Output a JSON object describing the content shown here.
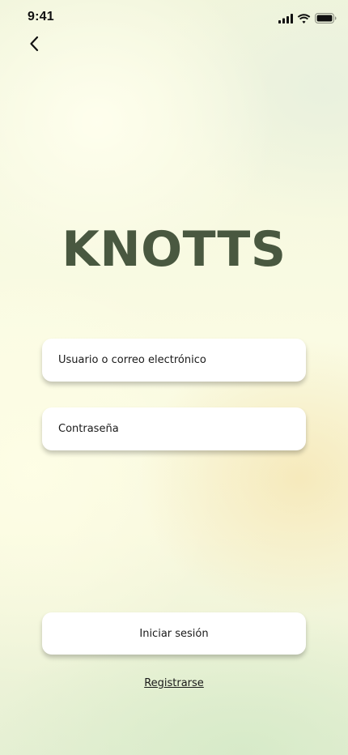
{
  "status_bar": {
    "time": "9:41",
    "icons": [
      "cellular-signal-icon",
      "wifi-icon",
      "battery-icon"
    ]
  },
  "navigation": {
    "back_icon": "chevron-left-icon"
  },
  "brand": {
    "logo_text": "KNOTTS",
    "logo_color": "#495840"
  },
  "form": {
    "username_placeholder": "Usuario o correo electrónico",
    "password_placeholder": "Contraseña"
  },
  "actions": {
    "login_label": "Iniciar sesión",
    "register_label": "Registrarse"
  }
}
